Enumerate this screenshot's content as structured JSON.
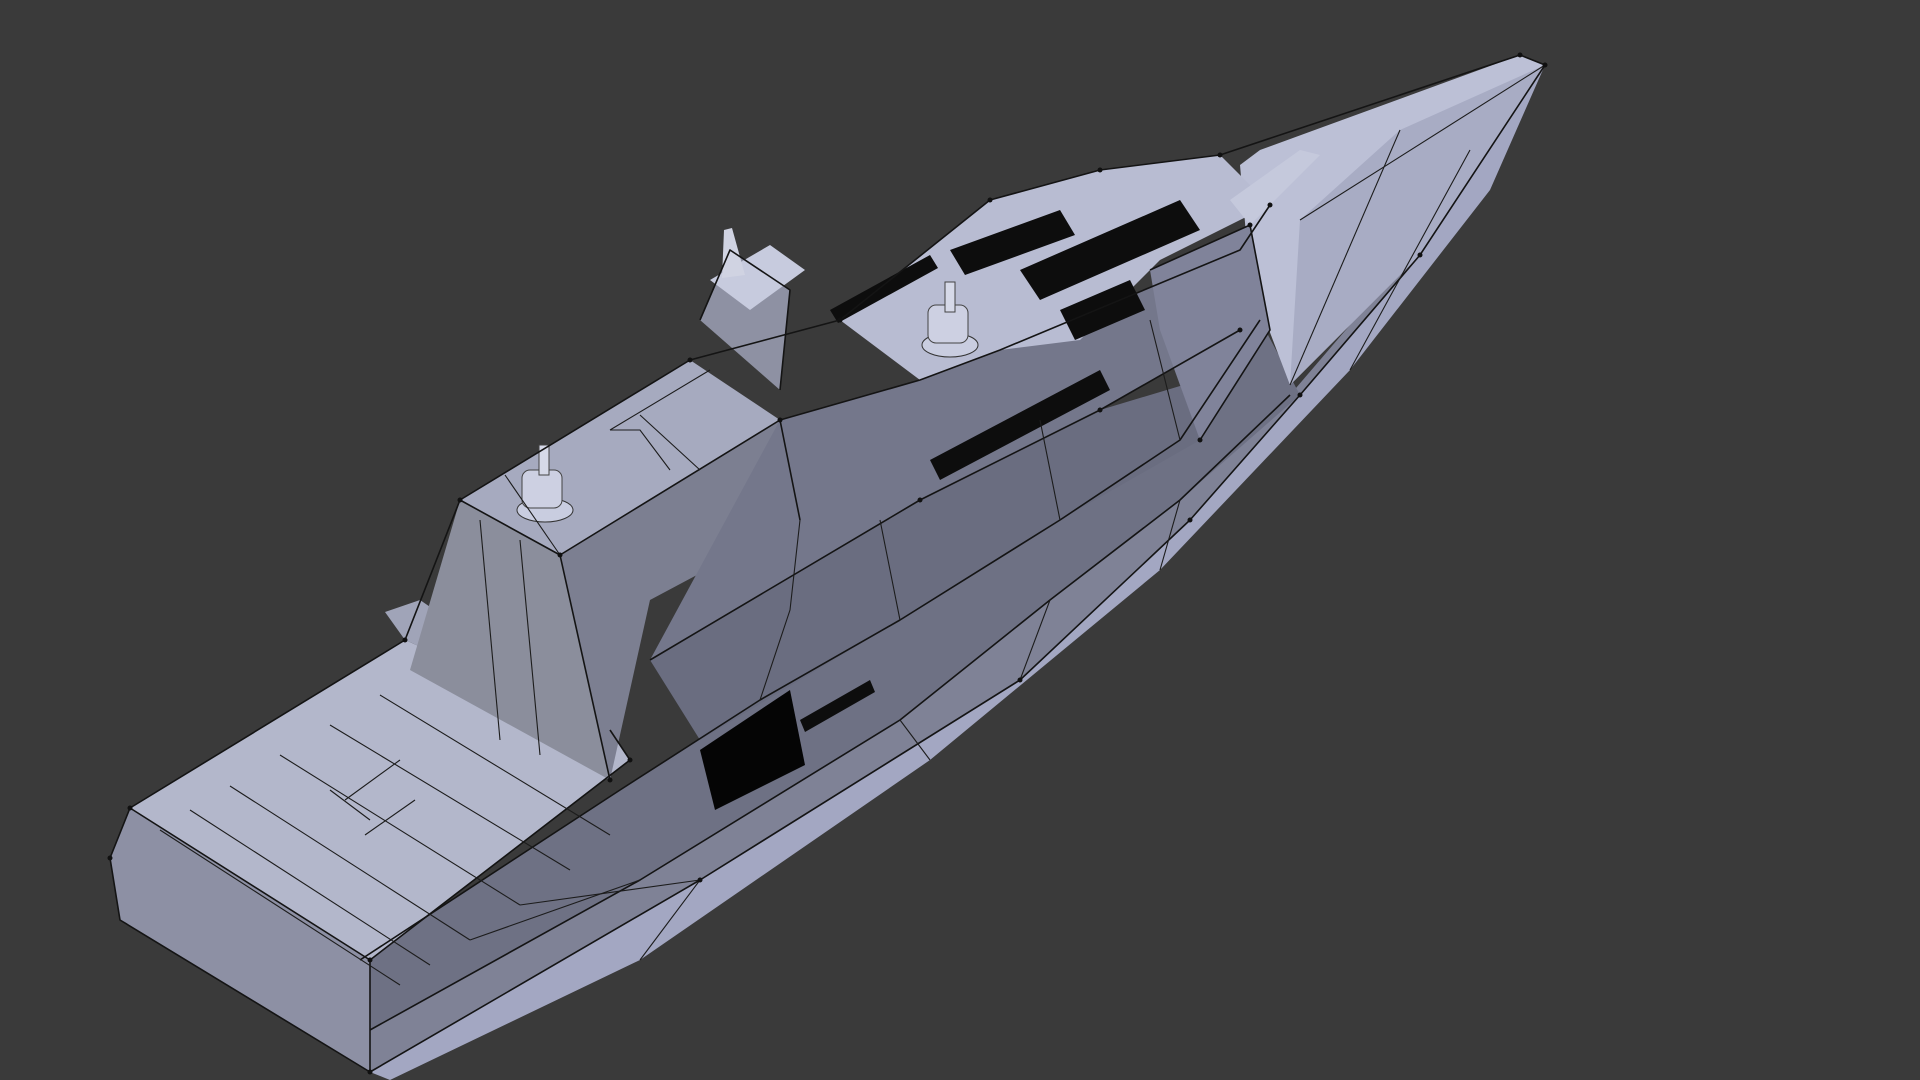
{
  "viewport": {
    "background": "#3a3a3a",
    "object": "stealth-corvette-mesh",
    "display_mode": "solid-wireframe"
  },
  "colors": {
    "deck_light": "#bfc3d6",
    "deck_mid": "#a9adc2",
    "hull_side": "#9da1b8",
    "hull_dark": "#787b8f",
    "super_left": "#8c8f9e",
    "super_dark": "#6b6d7c",
    "wire": "#141414",
    "grille": "#0b0b0b"
  }
}
